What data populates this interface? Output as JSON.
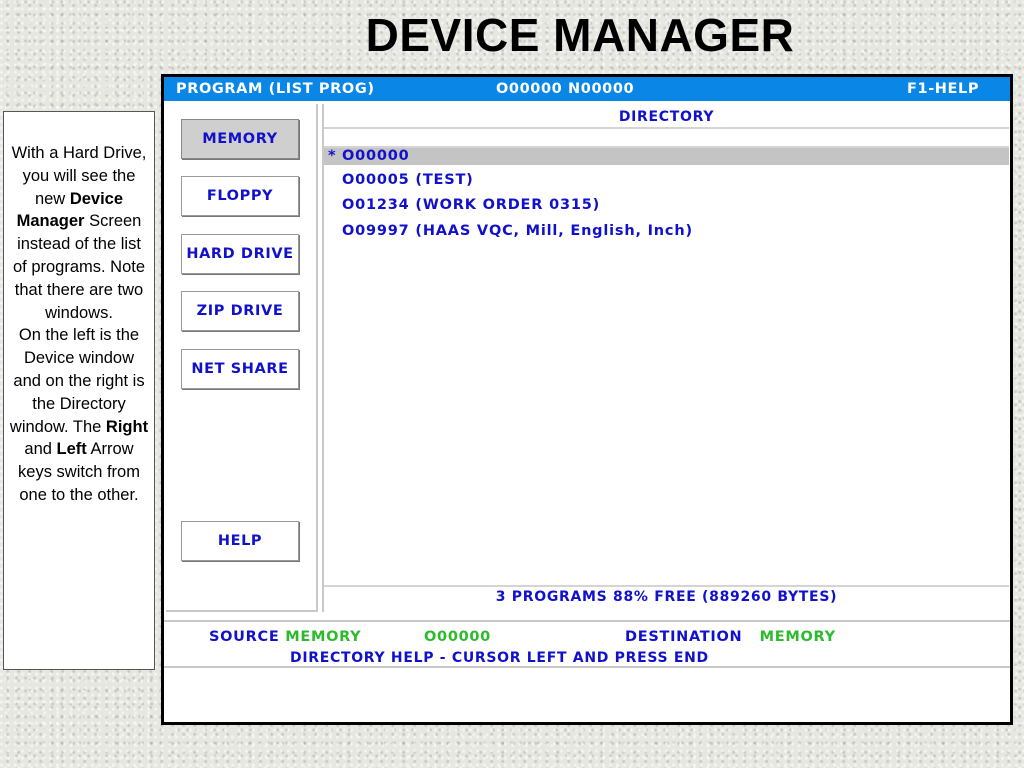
{
  "slide": {
    "title": "DEVICE MANAGER"
  },
  "note": {
    "p1": "With a Hard Drive, you will see the new",
    "p1_bold": "Device Manager",
    "p2": "Screen instead of the list of programs. Note that there are two windows.",
    "p3": "On the left is the Device window and on the right is the Directory window.  The",
    "p3_bold_right": "Right",
    "p3_and": "and",
    "p3_bold_left": "Left",
    "p4": "Arrow keys switch from one to the other."
  },
  "screen": {
    "topbar": {
      "mode": "PROGRAM  (LIST PROG)",
      "program": "O00000 N00000",
      "help": "F1-HELP"
    },
    "devices": [
      {
        "label": "MEMORY",
        "selected": true
      },
      {
        "label": "FLOPPY",
        "selected": false
      },
      {
        "label": "HARD DRIVE",
        "selected": false
      },
      {
        "label": "ZIP DRIVE",
        "selected": false
      },
      {
        "label": "NET SHARE",
        "selected": false
      },
      {
        "label": "HELP",
        "selected": false
      }
    ],
    "directory": {
      "title": "DIRECTORY",
      "selected_marker": "*",
      "rows": [
        "O00000",
        "O00005 (TEST)",
        "O01234 (WORK ORDER 0315)",
        "O09997 (HAAS VQC, Mill, English, Inch)"
      ],
      "footer": "3 PROGRAMS 88% FREE (889260 BYTES)"
    },
    "status": {
      "source_label": "SOURCE",
      "source_value": "MEMORY",
      "source_program": "O00000",
      "destination_label": "DESTINATION",
      "destination_value": "MEMORY",
      "help_text": "DIRECTORY HELP - CURSOR LEFT AND PRESS END"
    },
    "colors": {
      "topbar_bg": "#0a86e6",
      "text_blue": "#1111cc",
      "text_green": "#2dbb2d",
      "selected_bg": "#c4c4c4"
    }
  }
}
